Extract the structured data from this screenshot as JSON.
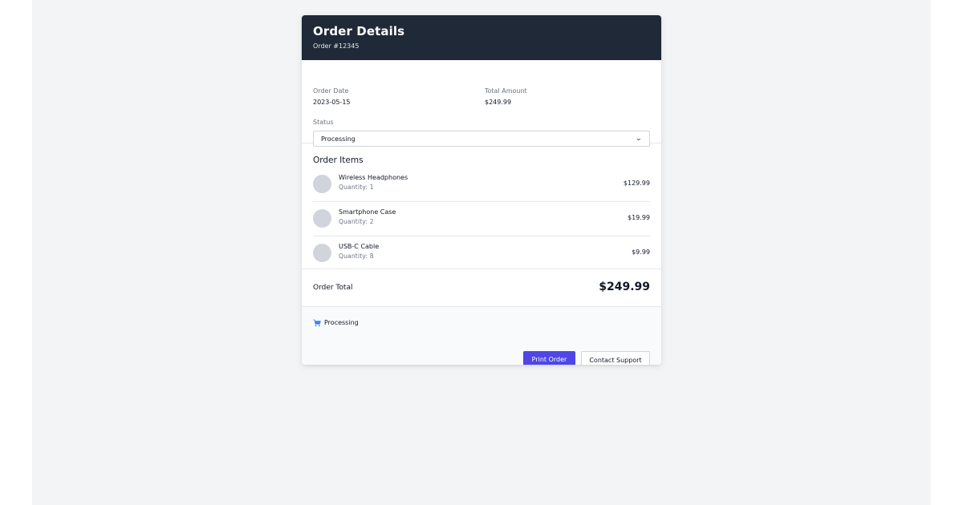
{
  "header": {
    "title": "Order Details",
    "order_number": "Order #12345"
  },
  "info": {
    "order_date_label": "Order Date",
    "order_date_value": "2023-05-15",
    "total_amount_label": "Total Amount",
    "total_amount_value": "$249.99",
    "status_label": "Status",
    "status_selected": "Processing"
  },
  "items": {
    "title": "Order Items",
    "list": [
      {
        "name": "Wireless Headphones",
        "quantity": "Quantity: 1",
        "price": "$129.99"
      },
      {
        "name": "Smartphone Case",
        "quantity": "Quantity: 2",
        "price": "$19.99"
      },
      {
        "name": "USB-C Cable",
        "quantity": "Quantity: 8",
        "price": "$9.99"
      }
    ]
  },
  "total": {
    "label": "Order Total",
    "value": "$249.99"
  },
  "footer": {
    "status_icon": "cart-icon",
    "status_text": "Processing",
    "print_button": "Print Order",
    "support_button": "Contact Support"
  },
  "colors": {
    "header_bg": "#1f2937",
    "primary": "#4f46e5",
    "status_icon": "#3b82f6",
    "page_bg": "#f3f4f6"
  }
}
